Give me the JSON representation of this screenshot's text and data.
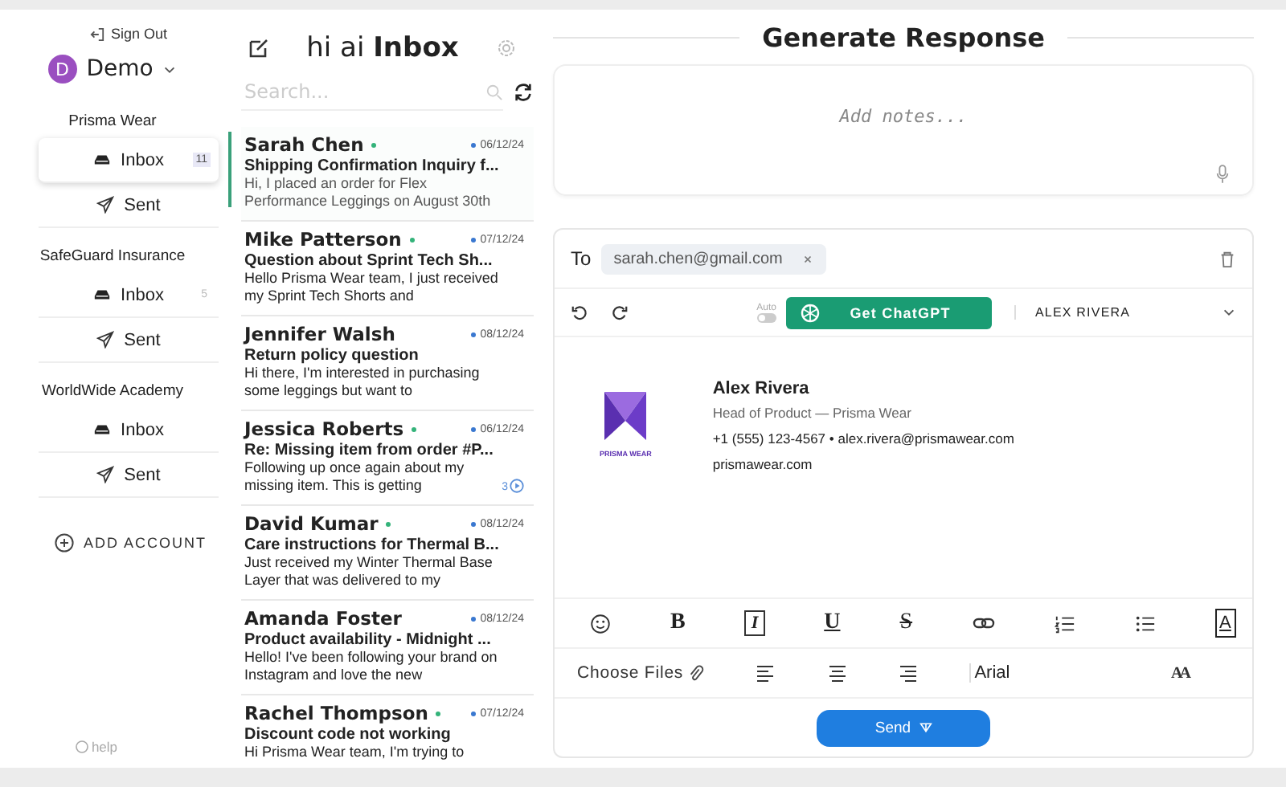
{
  "sidebar": {
    "sign_out": "Sign Out",
    "user": {
      "initial": "D",
      "name": "Demo"
    },
    "accounts": [
      {
        "name": "Prisma Wear",
        "folders": [
          {
            "kind": "inbox",
            "label": "Inbox",
            "count": "11",
            "selected": true
          },
          {
            "kind": "sent",
            "label": "Sent",
            "selected": false
          }
        ]
      },
      {
        "name": "SafeGuard Insurance",
        "folders": [
          {
            "kind": "inbox",
            "label": "Inbox",
            "count": "5",
            "selected": false
          },
          {
            "kind": "sent",
            "label": "Sent",
            "selected": false
          }
        ]
      },
      {
        "name": "WorldWide Academy",
        "folders": [
          {
            "kind": "inbox",
            "label": "Inbox",
            "selected": false
          },
          {
            "kind": "sent",
            "label": "Sent",
            "selected": false
          }
        ]
      }
    ],
    "add_account": "ADD ACCOUNT",
    "help": "help"
  },
  "inbox": {
    "title_prefix": "hi ai",
    "title": "Inbox",
    "search": {
      "placeholder": "Search..."
    },
    "messages": [
      {
        "sender": "Sarah Chen",
        "unread": true,
        "date": "06/12/24",
        "subject": "Shipping Confirmation Inquiry f...",
        "preview": "Hi, I placed an order for Flex Performance Leggings on August 30th",
        "selected": true
      },
      {
        "sender": "Mike Patterson",
        "unread": true,
        "date": "07/12/24",
        "subject": "Question about Sprint Tech Sh...",
        "preview": "Hello Prisma Wear team, I just received my Sprint Tech Shorts and",
        "selected": false
      },
      {
        "sender": "Jennifer Walsh",
        "unread": false,
        "date": "08/12/24",
        "subject": "Return policy question",
        "preview": "Hi there, I'm interested in purchasing some leggings but want to",
        "selected": false
      },
      {
        "sender": "Jessica Roberts",
        "unread": true,
        "date": "06/12/24",
        "subject": "Re: Missing item from order #P...",
        "preview": "Following up once again about my missing item. This is getting",
        "thread_count": "3",
        "selected": false
      },
      {
        "sender": "David Kumar",
        "unread": true,
        "date": "08/12/24",
        "subject": "Care instructions for Thermal B...",
        "preview": "Just received my Winter Thermal Base Layer that was delivered to my",
        "selected": false
      },
      {
        "sender": "Amanda Foster",
        "unread": false,
        "date": "08/12/24",
        "subject": "Product availability - Midnight ...",
        "preview": "Hello! I've been following your brand on Instagram and love the new",
        "selected": false
      },
      {
        "sender": "Rachel Thompson",
        "unread": true,
        "date": "07/12/24",
        "subject": "Discount code not working",
        "preview": "Hi Prisma Wear team, I'm trying to",
        "selected": false
      }
    ]
  },
  "compose": {
    "title": "Generate Response",
    "notes": {
      "placeholder": "Add notes..."
    },
    "to_label": "To",
    "recipients": [
      "sarah.chen@gmail.com"
    ],
    "auto_label": "Auto",
    "auto_on": false,
    "generate_button": "Get ChatGPT",
    "signer": "ALEX RIVERA",
    "signature": {
      "logo_text": "PRISMA WEAR",
      "name": "Alex Rivera",
      "role": "Head of Product — Prisma Wear",
      "contact": "+1 (555) 123-4567 • alex.rivera@prismawear.com",
      "website": "prismawear.com"
    },
    "toolbar": [
      {
        "kind": "emoji"
      },
      {
        "kind": "bold",
        "glyph": "B"
      },
      {
        "kind": "italic",
        "glyph": "I"
      },
      {
        "kind": "underline",
        "glyph": "U"
      },
      {
        "kind": "strike",
        "glyph": "S"
      },
      {
        "kind": "link"
      },
      {
        "kind": "ordered-list"
      },
      {
        "kind": "bullet-list"
      },
      {
        "kind": "text-color",
        "glyph": "A"
      }
    ],
    "attach_label": "Choose Files",
    "font": "Arial",
    "size_glyph": "AA",
    "send_button": "Send"
  }
}
